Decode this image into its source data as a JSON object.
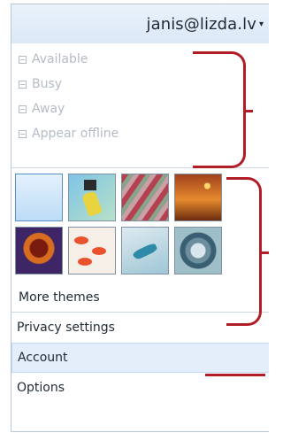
{
  "header": {
    "account": "janis@lizda.lv",
    "caret": "▾"
  },
  "status": {
    "items": [
      {
        "label": "Available"
      },
      {
        "label": "Busy"
      },
      {
        "label": "Away"
      },
      {
        "label": "Appear offline"
      }
    ]
  },
  "themes": {
    "more_label": "More themes"
  },
  "menu": {
    "privacy": "Privacy settings",
    "account": "Account",
    "options": "Options"
  },
  "colors": {
    "annotation": "#b01d26",
    "highlight": "#e4eefa"
  }
}
